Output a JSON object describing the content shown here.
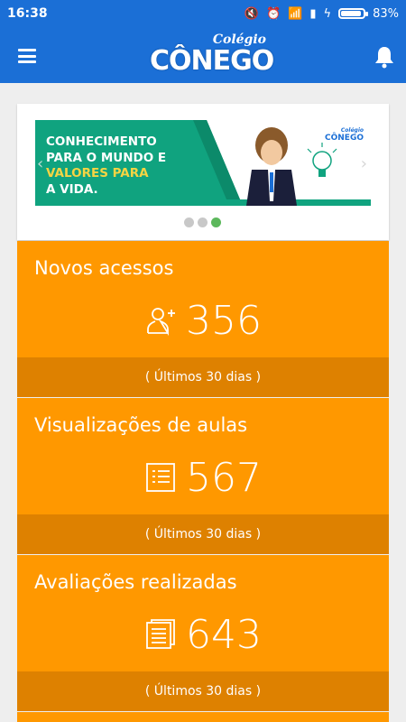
{
  "status_bar": {
    "time": "16:38",
    "battery": "83%",
    "battery_level": 0.83
  },
  "app": {
    "logo_script": "Colégio",
    "logo_main": "CÔNEGO"
  },
  "banner": {
    "line1": "CONHECIMENTO",
    "line2": "PARA O MUNDO E",
    "line3": "VALORES PARA",
    "line4": "A VIDA.",
    "logo_script": "Colégio",
    "logo_main": "CÔNEGO",
    "dots_count": 3,
    "active_dot": 2
  },
  "stats": [
    {
      "title": "Novos acessos",
      "value": "356",
      "footer": "( Últimos 30 dias )",
      "icon": "user-add-icon"
    },
    {
      "title": "Visualizações de aulas",
      "value": "567",
      "footer": "( Últimos 30 dias )",
      "icon": "list-icon"
    },
    {
      "title": "Avaliações realizadas",
      "value": "643",
      "footer": "( Últimos 30 dias )",
      "icon": "document-list-icon"
    }
  ],
  "colors": {
    "primary": "#1b6fd6",
    "stat_bg": "#ff9800",
    "stat_footer": "#de8100",
    "banner_green": "#10a37f",
    "dot_active": "#5cb85c"
  }
}
